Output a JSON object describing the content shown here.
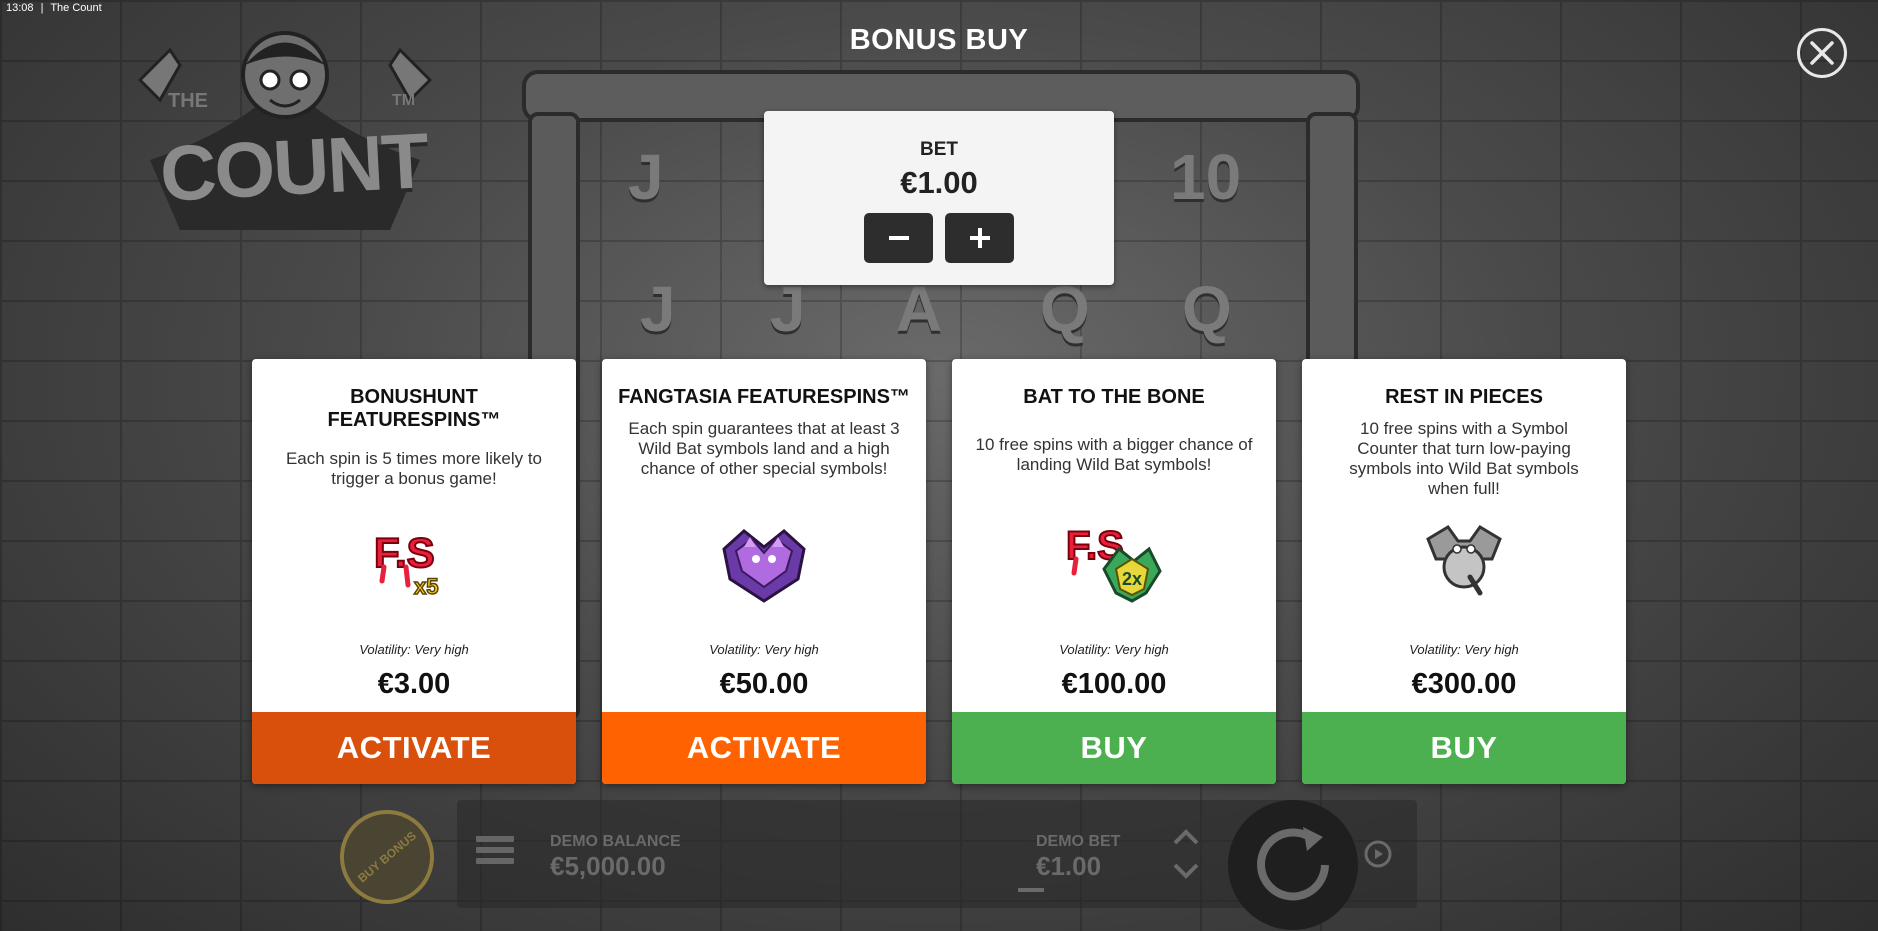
{
  "status_bar": {
    "time": "13:08",
    "separator": "|",
    "app_title": "The Count"
  },
  "logo": {
    "word_top": "THE",
    "word_main": "COUNT",
    "trademark": "TM"
  },
  "modal": {
    "title": "BONUS BUY",
    "bet": {
      "label": "BET",
      "value": "€1.00",
      "minus": "−",
      "plus": "+"
    },
    "cards": [
      {
        "title": "BONUSHUNT FEATURESPINS™",
        "description": "Each spin is 5 times more likely to trigger a bonus game!",
        "icon": "fs-x5-icon",
        "icon_text": "F.S",
        "icon_badge": "x5",
        "volatility": "Volatility: Very high",
        "price": "€3.00",
        "button": "ACTIVATE",
        "button_color": "#d94f0c"
      },
      {
        "title": "FANGTASIA FEATURESPINS™",
        "description": "Each spin guarantees that at least 3 Wild Bat symbols land and a high chance of other special symbols!",
        "icon": "purple-bats-icon",
        "volatility": "Volatility: Very high",
        "price": "€50.00",
        "button": "ACTIVATE",
        "button_color": "#ff6200"
      },
      {
        "title": "BAT TO THE BONE",
        "description": "10 free spins with a bigger chance of landing Wild Bat symbols!",
        "icon": "fs-2x-bat-icon",
        "icon_text": "F.S",
        "icon_badge": "2x",
        "volatility": "Volatility: Very high",
        "price": "€100.00",
        "button": "BUY",
        "button_color": "#4caf50"
      },
      {
        "title": "REST IN PIECES",
        "description": "10 free spins with a Symbol Counter that turn low-paying symbols into Wild Bat symbols when full!",
        "icon": "grey-bat-symbol-icon",
        "volatility": "Volatility: Very high",
        "price": "€300.00",
        "button": "BUY",
        "button_color": "#4caf50"
      }
    ]
  },
  "bottom_bar": {
    "buy_bonus": "BUY BONUS",
    "demo_balance_label": "DEMO BALANCE",
    "demo_balance_value": "€5,000.00",
    "demo_bet_label": "DEMO BET",
    "demo_bet_value": "€1.00"
  },
  "background_reels": [
    "J",
    "10",
    "J",
    "J",
    "A",
    "Q",
    "Q"
  ],
  "colors": {
    "accent_orange": "#d94f0c",
    "accent_orange_bright": "#ff6200",
    "accent_green": "#4caf50",
    "modal_bg": "#f4f4f4"
  }
}
